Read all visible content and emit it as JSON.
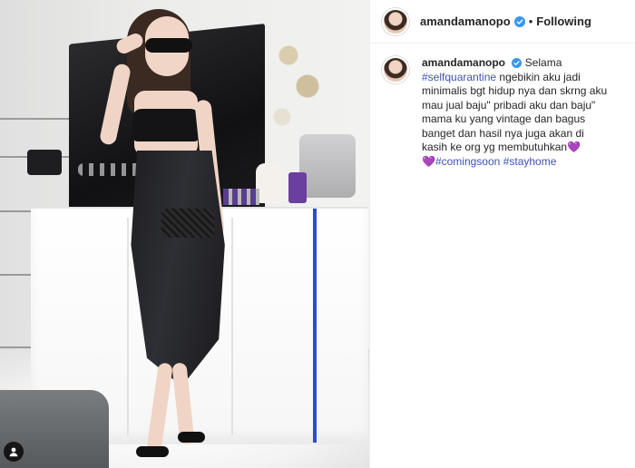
{
  "post": {
    "username": "amandamanopo",
    "follow_status": "Following",
    "separator": "•",
    "caption": {
      "part1": "Selama ",
      "tag1": "#selfquarantine",
      "part2": " ngebikin aku jadi minimalis bgt hidup nya dan skrng aku mau jual baju\" pribadi aku dan baju\" mama ku yang vintage dan bagus banget dan hasil nya juga akan di kasih ke org yg membutuhkan",
      "heart_emoji": "💜",
      "tag2": "#comingsoon",
      "tag3": "#stayhome"
    }
  },
  "colors": {
    "verified_badge": "#3897f0",
    "hashtag": "#3f51b5",
    "text": "#262626"
  },
  "icons": {
    "verified": "verified-badge-icon",
    "tag_people": "user-tag-icon"
  }
}
